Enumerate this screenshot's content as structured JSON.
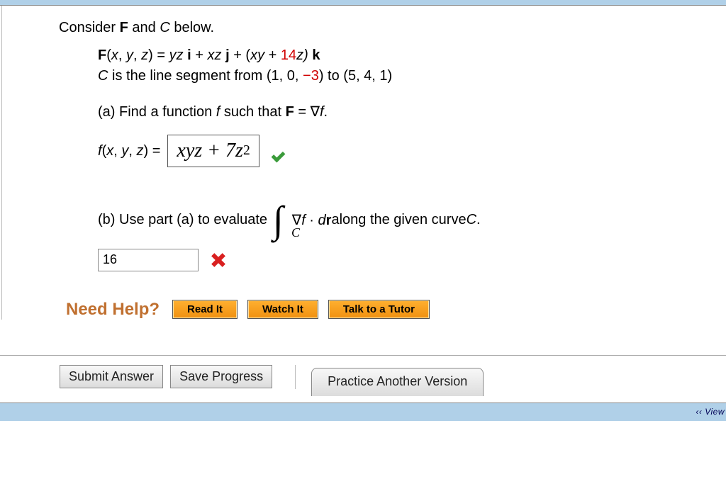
{
  "intro": "Consider F and C below.",
  "equation": {
    "prefix": "F",
    "args": "(x, y, z) = ",
    "term1": "yz ",
    "i": "i",
    "plus1": " + ",
    "term2": "xz ",
    "j": "j",
    "plus2": " + (",
    "term3": "xy",
    "plus3": " + ",
    "red14": "14",
    "term4": "z) ",
    "k": "k"
  },
  "curve": {
    "prefix": "C",
    "text1": " is the line segment from (1, 0, ",
    "neg3": "−3",
    "text2": ") to (5, 4, 1)"
  },
  "partA": {
    "label": "(a) Find a function ",
    "f": "f",
    "label2": " such that ",
    "F": "F",
    "eq": " = ∇",
    "fend": "f",
    "period": ".",
    "answer_label_f": "f",
    "answer_label_args": "(x, y, z) = ",
    "answer_body": "xyz + 7z",
    "answer_exp": "2"
  },
  "partB": {
    "label1": "(b) Use part (a) to evaluate",
    "integrand": "∇f · d",
    "r": "r",
    "label2": "  along the given curve ",
    "C": "C",
    "period": ".",
    "sub": "C",
    "input_value": "16"
  },
  "help": {
    "label": "Need Help?",
    "read": "Read It",
    "watch": "Watch It",
    "tutor": "Talk to a Tutor"
  },
  "buttons": {
    "submit": "Submit Answer",
    "save": "Save Progress",
    "practice": "Practice Another Version"
  },
  "footer_partial": "‹‹ View"
}
